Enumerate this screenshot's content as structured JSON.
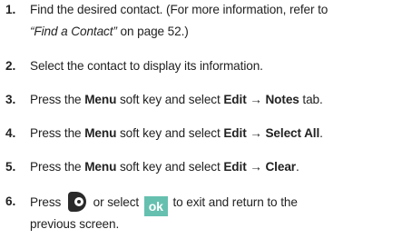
{
  "steps": [
    {
      "num": "1.",
      "line1": "Find the desired contact. (For more information, refer to",
      "ref": "“Find a Contact”",
      "page": " on page 52.)"
    },
    {
      "num": "2.",
      "text": "Select the contact to display its information."
    },
    {
      "num": "3.",
      "pre": "Press the ",
      "key": "Menu",
      "mid": " soft key and select ",
      "menu": "Edit → Notes",
      "post": " tab."
    },
    {
      "num": "4.",
      "pre": "Press the ",
      "key": "Menu",
      "mid": " soft key and select ",
      "menu": "Edit → Select All",
      "post": "."
    },
    {
      "num": "5.",
      "pre": "Press the ",
      "key": "Menu",
      "mid": " soft key and select ",
      "menu": "Edit → Clear",
      "post": "."
    },
    {
      "num": "6.",
      "pre": "Press",
      "mid": "or select",
      "ok_label": "ok",
      "post": "to exit and return to the",
      "line2": "previous screen."
    }
  ],
  "icons": {
    "ok_key_icon": "ok-key-icon",
    "ok_button_color": "#66c0b0"
  }
}
